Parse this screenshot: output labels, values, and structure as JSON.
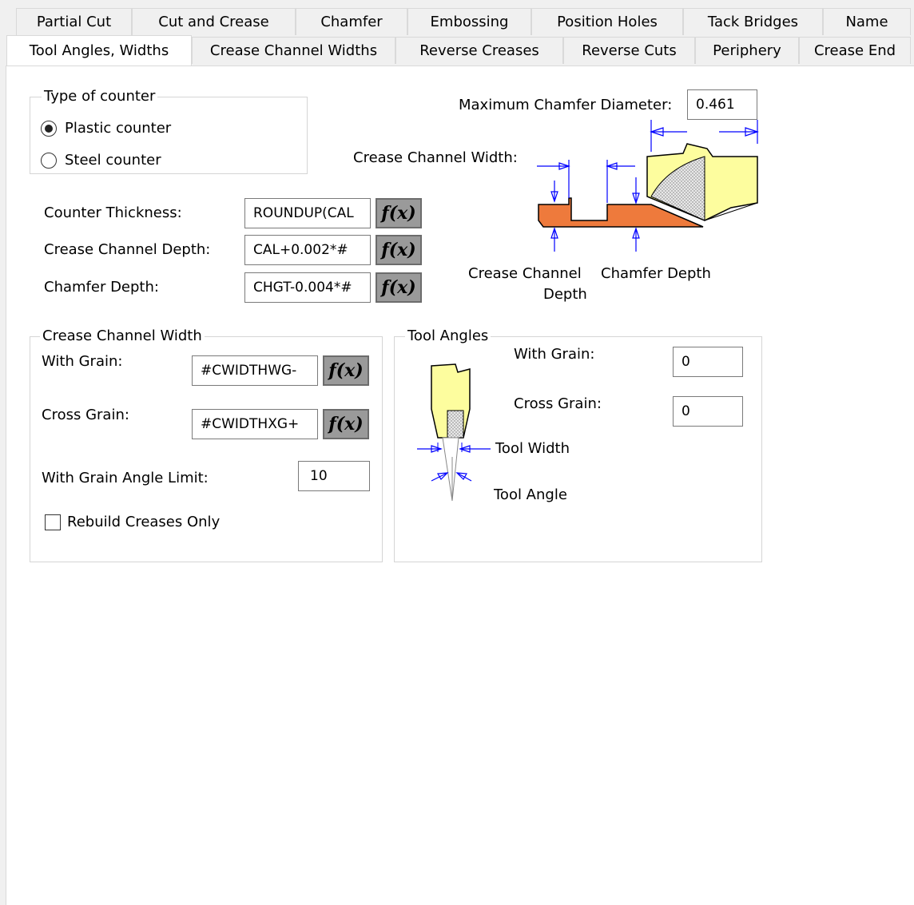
{
  "tabs_top": [
    "Partial Cut",
    "Cut and Crease",
    "Chamfer",
    "Embossing",
    "Position Holes",
    "Tack Bridges",
    "Name"
  ],
  "tabs_bottom": [
    "Tool Angles, Widths",
    "Crease Channel Widths",
    "Reverse Creases",
    "Reverse Cuts",
    "Periphery",
    "Crease End"
  ],
  "active_tab": "Tool Angles, Widths",
  "counter_type": {
    "title": "Type of counter",
    "options": [
      "Plastic counter",
      "Steel counter"
    ],
    "selected": "Plastic counter"
  },
  "fields": {
    "counter_thickness": {
      "label": "Counter Thickness:",
      "value": "ROUNDUP(CAL"
    },
    "crease_channel_depth": {
      "label": "Crease Channel Depth:",
      "value": "CAL+0.002*#"
    },
    "chamfer_depth": {
      "label": "Chamfer Depth:",
      "value": "CHGT-0.004*#"
    },
    "fx_label": "f(x)"
  },
  "chamfer_diagram": {
    "max_chamfer_label": "Maximum Chamfer Diameter:",
    "max_chamfer_value": "0.461",
    "crease_channel_width_label": "Crease Channel Width:",
    "crease_channel_depth_label_1": "Crease Channel",
    "crease_channel_depth_label_2": "Depth",
    "chamfer_depth_label": "Chamfer Depth"
  },
  "crease_channel_width": {
    "title": "Crease Channel Width",
    "with_grain_label": "With Grain:",
    "with_grain_value": "#CWIDTHWG-",
    "cross_grain_label": "Cross Grain:",
    "cross_grain_value": "#CWIDTHXG+",
    "angle_limit_label": "With Grain Angle Limit:",
    "angle_limit_value": "10",
    "rebuild_label": "Rebuild Creases Only",
    "rebuild_checked": false
  },
  "tool_angles": {
    "title": "Tool Angles",
    "with_grain_label": "With Grain:",
    "with_grain_value": "0",
    "cross_grain_label": "Cross Grain:",
    "cross_grain_value": "0",
    "tool_width_label": "Tool Width",
    "tool_angle_label": "Tool Angle"
  }
}
